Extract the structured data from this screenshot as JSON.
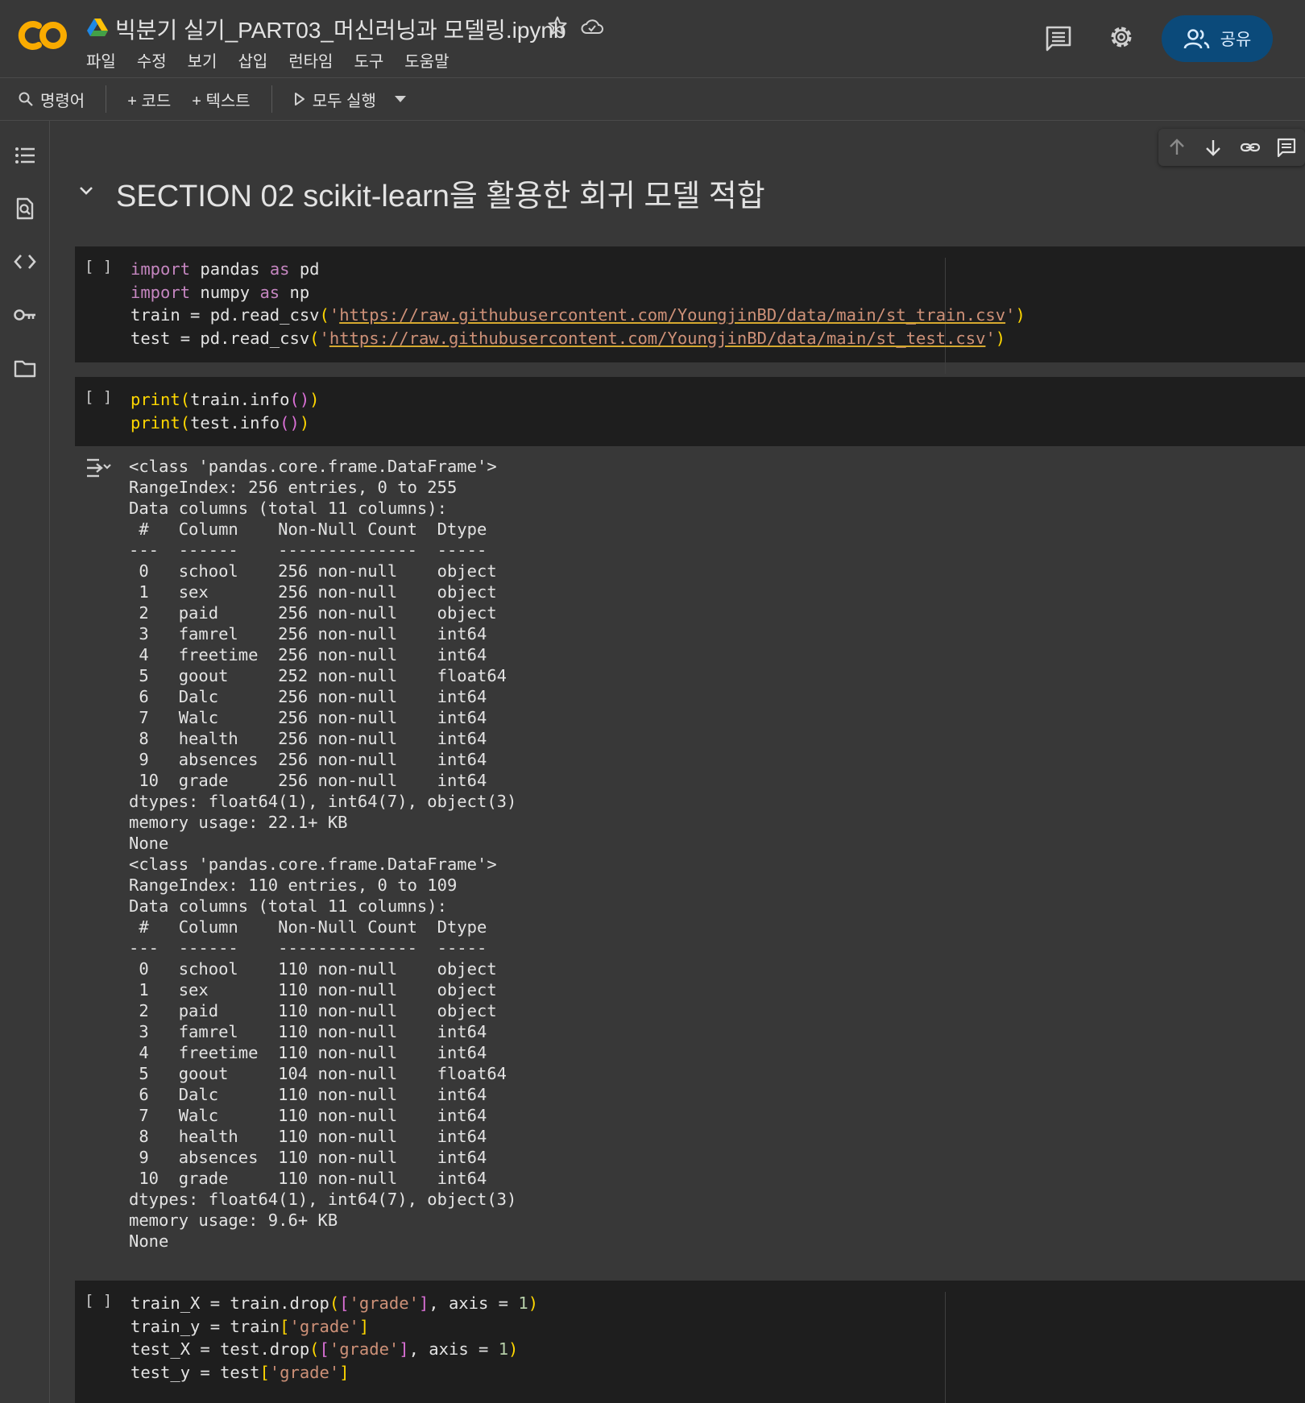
{
  "header": {
    "notebook_title": "빅분기 실기_PART03_머신러닝과 모델링.ipynb",
    "menu": [
      "파일",
      "수정",
      "보기",
      "삽입",
      "런타임",
      "도구",
      "도움말"
    ],
    "share_label": "공유"
  },
  "toolbar": {
    "commands_label": "명령어",
    "add_code_label": "+ 코드",
    "add_text_label": "+ 텍스트",
    "run_all_label": "모두 실행"
  },
  "section": {
    "title": "SECTION 02 scikit-learn을 활용한 회귀 모델 적합"
  },
  "cells": {
    "run_label": "[ ]",
    "cell1": {
      "lines": [
        "import pandas as pd",
        "import numpy as np",
        "train = pd.read_csv('https://raw.githubusercontent.com/YoungjinBD/data/main/st_train.csv')",
        "test = pd.read_csv('https://raw.githubusercontent.com/YoungjinBD/data/main/st_test.csv')"
      ],
      "train_url": "https://raw.githubusercontent.com/YoungjinBD/data/main/st_train.csv",
      "test_url": "https://raw.githubusercontent.com/YoungjinBD/data/main/st_test.csv"
    },
    "cell2": {
      "lines": [
        "print(train.info())",
        "print(test.info())"
      ]
    },
    "cell3": {
      "lines": [
        "train_X = train.drop(['grade'], axis = 1)",
        "train_y = train['grade']",
        "test_X = test.drop(['grade'], axis = 1)",
        "test_y = test['grade']"
      ]
    }
  },
  "output": {
    "text": "<class 'pandas.core.frame.DataFrame'>\nRangeIndex: 256 entries, 0 to 255\nData columns (total 11 columns):\n #   Column    Non-Null Count  Dtype  \n---  ------    --------------  -----  \n 0   school    256 non-null    object \n 1   sex       256 non-null    object \n 2   paid      256 non-null    object \n 3   famrel    256 non-null    int64  \n 4   freetime  256 non-null    int64  \n 5   goout     252 non-null    float64\n 6   Dalc      256 non-null    int64  \n 7   Walc      256 non-null    int64  \n 8   health    256 non-null    int64  \n 9   absences  256 non-null    int64  \n 10  grade     256 non-null    int64  \ndtypes: float64(1), int64(7), object(3)\nmemory usage: 22.1+ KB\nNone\n<class 'pandas.core.frame.DataFrame'>\nRangeIndex: 110 entries, 0 to 109\nData columns (total 11 columns):\n #   Column    Non-Null Count  Dtype  \n---  ------    --------------  -----  \n 0   school    110 non-null    object \n 1   sex       110 non-null    object \n 2   paid      110 non-null    object \n 3   famrel    110 non-null    int64  \n 4   freetime  110 non-null    int64  \n 5   goout     104 non-null    float64\n 6   Dalc      110 non-null    int64  \n 7   Walc      110 non-null    int64  \n 8   health    110 non-null    int64  \n 9   absences  110 non-null    int64  \n 10  grade     110 non-null    int64  \ndtypes: float64(1), int64(7), object(3)\nmemory usage: 9.6+ KB\nNone"
  },
  "colors": {
    "background": "#383838",
    "cell_background": "#1e1e1e",
    "keyword": "#c586c0",
    "string": "#ce9178",
    "bracket": "#ffd700",
    "share_button": "#0b4a7a",
    "logo_orange": "#f9ab00"
  },
  "icons": [
    "colab-logo-icon",
    "drive-icon",
    "star-icon",
    "cloud-icon",
    "comment-icon",
    "gear-icon",
    "share-people-icon",
    "search-icon",
    "play-icon",
    "dropdown-caret-icon",
    "toc-icon",
    "find-icon",
    "code-snippets-icon",
    "key-icon",
    "folder-icon",
    "collapse-chevron-icon",
    "arrow-up-icon",
    "arrow-down-icon",
    "link-icon",
    "cell-comment-icon",
    "output-toggle-icon"
  ]
}
